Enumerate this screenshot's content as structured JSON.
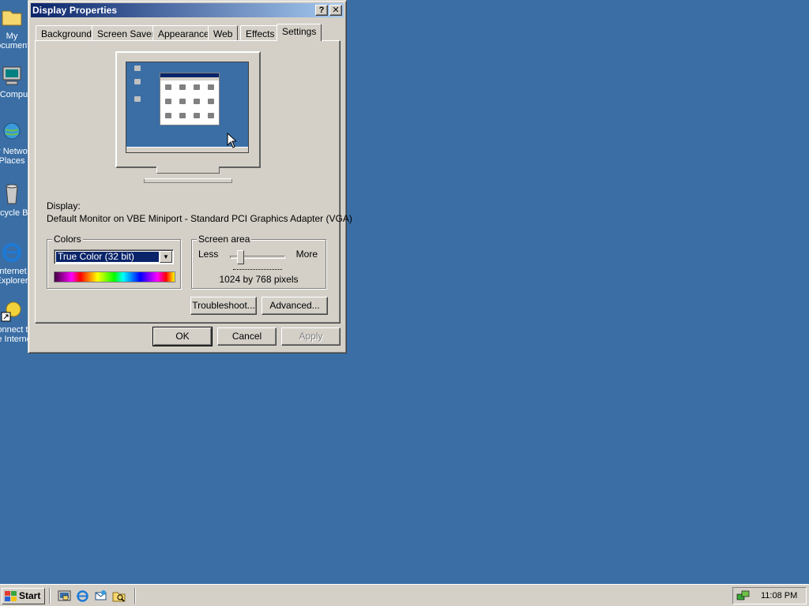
{
  "desktop": {
    "icons": [
      {
        "name": "my-documents",
        "label": "My Documents"
      },
      {
        "name": "my-computer",
        "label": "My Computer"
      },
      {
        "name": "my-network-places",
        "label": "My Network\nPlaces"
      },
      {
        "name": "recycle-bin",
        "label": "Recycle Bin"
      },
      {
        "name": "internet-explorer",
        "label": "Internet\nExplorer"
      },
      {
        "name": "connect-internet",
        "label": "Connect to\nthe Internet"
      }
    ]
  },
  "window": {
    "title": "Display Properties",
    "help_label": "?",
    "close_label": "✕",
    "tabs": [
      {
        "label": "Background"
      },
      {
        "label": "Screen Saver"
      },
      {
        "label": "Appearance"
      },
      {
        "label": "Web"
      },
      {
        "label": "Effects"
      },
      {
        "label": "Settings",
        "active": true
      }
    ],
    "display_label": "Display:",
    "display_value": "Default Monitor on VBE Miniport - Standard PCI Graphics Adapter (VGA)",
    "colors": {
      "title": "Colors",
      "selected": "True Color (32 bit)"
    },
    "screen_area": {
      "title": "Screen area",
      "less": "Less",
      "more": "More",
      "value": "1024 by 768 pixels",
      "slider_fraction": 0.15
    },
    "buttons": {
      "troubleshoot": "Troubleshoot...",
      "advanced": "Advanced...",
      "ok": "OK",
      "cancel": "Cancel",
      "apply": "Apply"
    }
  },
  "taskbar": {
    "start_label": "Start",
    "quick_launch": [
      "show-desktop-icon",
      "internet-explorer-icon",
      "outlook-express-icon",
      "windows-explorer-icon"
    ],
    "clock": "11:08 PM"
  },
  "colors": {
    "desktop": "#3a6ea5",
    "face": "#d4d0c8",
    "title_start": "#0a246a",
    "title_end": "#a6caf0"
  }
}
